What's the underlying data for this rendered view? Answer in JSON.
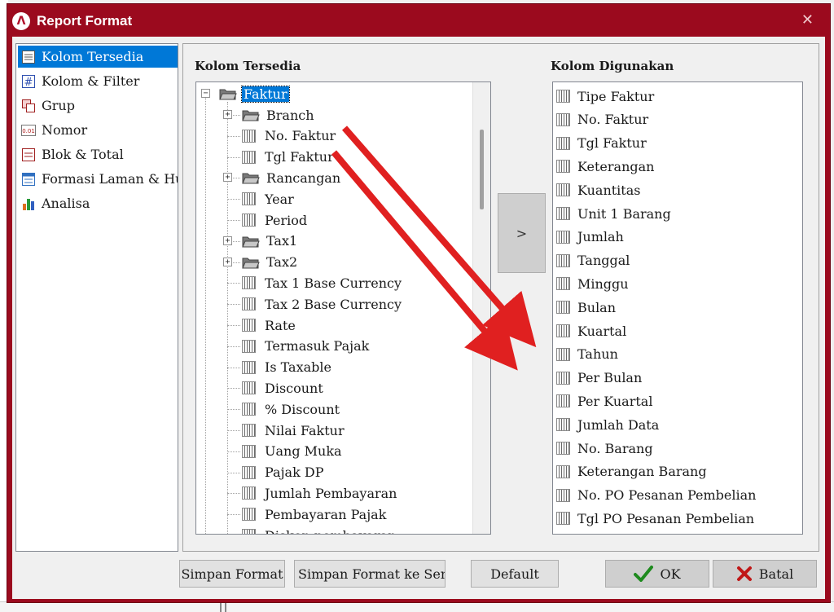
{
  "window": {
    "title": "Report Format",
    "close_glyph": "✕",
    "logo_glyph": "Λ"
  },
  "nav": {
    "items": [
      {
        "label": "Kolom Tersedia",
        "icon": "list-document-icon",
        "selected": true
      },
      {
        "label": "Kolom & Filter",
        "icon": "hash-icon"
      },
      {
        "label": "Grup",
        "icon": "group-icon"
      },
      {
        "label": "Nomor",
        "icon": "number-icon"
      },
      {
        "label": "Blok & Total",
        "icon": "block-total-icon"
      },
      {
        "label": "Formasi Laman & Huruf",
        "icon": "page-format-icon"
      },
      {
        "label": "Analisa",
        "icon": "bar-chart-icon"
      }
    ]
  },
  "available": {
    "heading": "Kolom Tersedia",
    "root": "Faktur",
    "nodes": [
      {
        "label": "Branch",
        "type": "folder"
      },
      {
        "label": "No. Faktur",
        "type": "field"
      },
      {
        "label": "Tgl Faktur",
        "type": "field"
      },
      {
        "label": "Rancangan",
        "type": "folder"
      },
      {
        "label": "Year",
        "type": "field"
      },
      {
        "label": "Period",
        "type": "field"
      },
      {
        "label": "Tax1",
        "type": "folder"
      },
      {
        "label": "Tax2",
        "type": "folder"
      },
      {
        "label": "Tax 1 Base Currency",
        "type": "field"
      },
      {
        "label": "Tax 2 Base Currency",
        "type": "field"
      },
      {
        "label": "Rate",
        "type": "field"
      },
      {
        "label": "Termasuk Pajak",
        "type": "field"
      },
      {
        "label": "Is Taxable",
        "type": "field"
      },
      {
        "label": "Discount",
        "type": "field"
      },
      {
        "label": "% Discount",
        "type": "field"
      },
      {
        "label": "Nilai Faktur",
        "type": "field"
      },
      {
        "label": "Uang Muka",
        "type": "field"
      },
      {
        "label": "Pajak DP",
        "type": "field"
      },
      {
        "label": "Jumlah Pembayaran",
        "type": "field"
      },
      {
        "label": "Pembayaran Pajak",
        "type": "field"
      },
      {
        "label": "Diskon pembayaran",
        "type": "field"
      }
    ]
  },
  "move_button": ">",
  "used": {
    "heading": "Kolom Digunakan",
    "items": [
      "Tipe Faktur",
      "No. Faktur",
      "Tgl Faktur",
      "Keterangan",
      "Kuantitas",
      "Unit 1 Barang",
      "Jumlah",
      "Tanggal",
      "Minggu",
      "Bulan",
      "Kuartal",
      "Tahun",
      "Per Bulan",
      "Per Kuartal",
      "Jumlah Data",
      "No. Barang",
      "Keterangan Barang",
      "No. PO Pesanan Pembelian",
      "Tgl PO Pesanan Pembelian"
    ]
  },
  "buttons": {
    "save_format": "Simpan Format",
    "save_format_all": "Simpan Format ke Semua",
    "default": "Default",
    "ok": "OK",
    "cancel": "Batal"
  },
  "colors": {
    "titlebar": "#9b0a1e",
    "selection": "#0078d7",
    "annotation_arrow": "#e02020",
    "ok_check": "#1e8a1e",
    "cancel_x": "#c01818"
  }
}
